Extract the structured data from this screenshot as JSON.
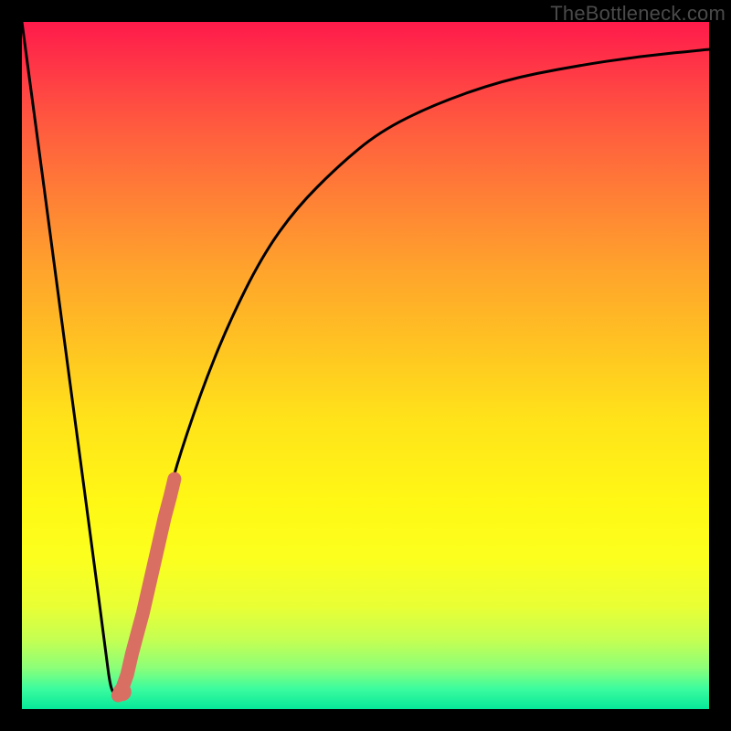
{
  "watermark": "TheBottleneck.com",
  "chart_data": {
    "type": "line",
    "title": "",
    "xlabel": "",
    "ylabel": "",
    "xlim": [
      0,
      100
    ],
    "ylim": [
      0,
      100
    ],
    "series": [
      {
        "name": "bottleneck-curve",
        "x": [
          0,
          2,
          4,
          6,
          8,
          10,
          12,
          13,
          14,
          16,
          19,
          22,
          26,
          30,
          35,
          40,
          46,
          52,
          60,
          70,
          80,
          90,
          100
        ],
        "y": [
          100,
          85,
          70,
          55,
          40,
          25,
          10,
          2,
          3,
          10,
          22,
          34,
          46,
          56,
          66,
          73,
          79,
          84,
          88,
          91.5,
          93.5,
          95,
          96
        ]
      }
    ],
    "highlight_segment": {
      "name": "highlight-dots",
      "color": "#d96f63",
      "points": [
        {
          "x": 14.0,
          "y": 2.0
        },
        {
          "x": 14.6,
          "y": 3.0
        },
        {
          "x": 15.3,
          "y": 5.0
        },
        {
          "x": 16.0,
          "y": 8.0
        },
        {
          "x": 16.8,
          "y": 11.0
        },
        {
          "x": 17.6,
          "y": 14.0
        },
        {
          "x": 18.4,
          "y": 17.5
        },
        {
          "x": 19.2,
          "y": 21.0
        },
        {
          "x": 20.0,
          "y": 24.5
        },
        {
          "x": 20.8,
          "y": 28.0
        },
        {
          "x": 21.6,
          "y": 31.0
        },
        {
          "x": 22.2,
          "y": 33.5
        }
      ]
    }
  }
}
